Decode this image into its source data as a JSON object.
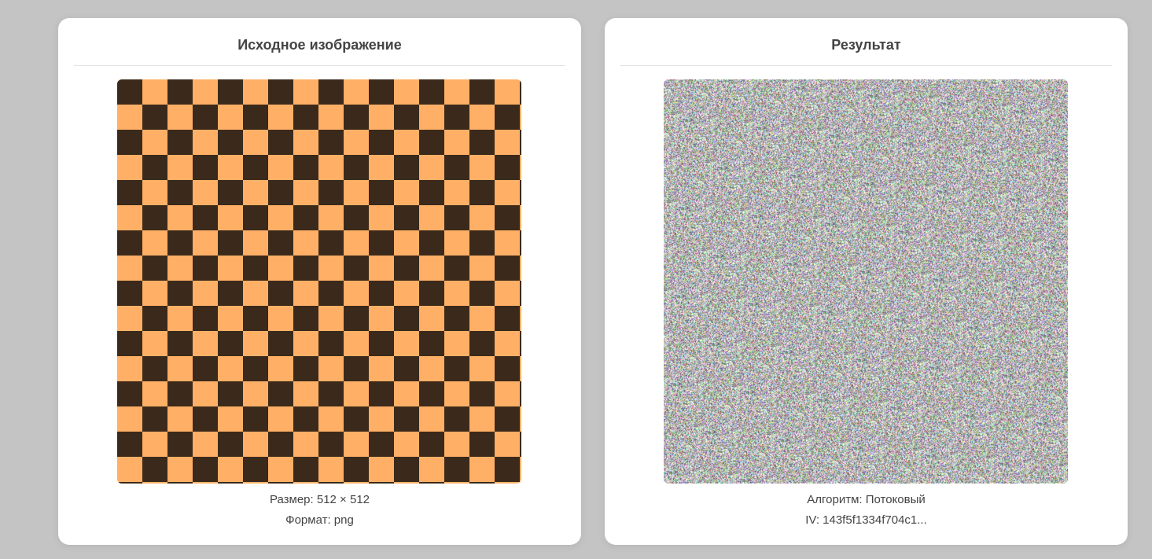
{
  "original": {
    "title": "Исходное изображение",
    "size_line": "Размер: 512 × 512",
    "format_line": "Формат: png",
    "pattern_colors": {
      "light": "#ffb066",
      "dark": "#3b2a1b"
    }
  },
  "result": {
    "title": "Результат",
    "algorithm_line": "Алгоритм: Потоковый",
    "iv_line": "IV: 143f5f1334f704c1..."
  }
}
